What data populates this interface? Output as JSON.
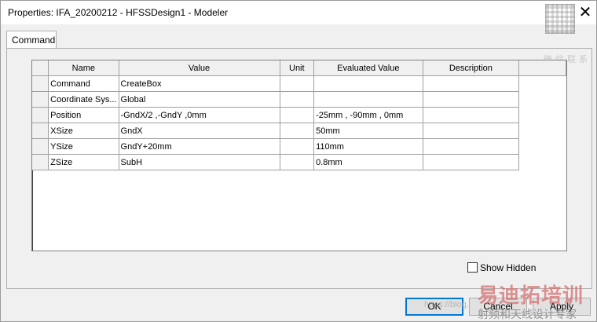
{
  "window": {
    "title": "Properties: IFA_20200212 - HFSSDesign1 - Modeler",
    "close_glyph": "✕"
  },
  "watermark": {
    "qr_caption": "微信联系",
    "url": "https://blog.",
    "cn_title": "易迪拓培训",
    "cn_subtitle": "射频和天线设计专家"
  },
  "tabs": [
    {
      "label": "Command"
    }
  ],
  "grid": {
    "columns": [
      "Name",
      "Value",
      "Unit",
      "Evaluated Value",
      "Description"
    ],
    "rows": [
      {
        "name": "Command",
        "value": "CreateBox",
        "unit": "",
        "evaluated": "",
        "description": ""
      },
      {
        "name": "Coordinate Sys...",
        "value": "Global",
        "unit": "",
        "evaluated": "",
        "description": ""
      },
      {
        "name": "Position",
        "value": "-GndX/2 ,-GndY ,0mm",
        "unit": "",
        "evaluated": "-25mm , -90mm , 0mm",
        "description": ""
      },
      {
        "name": "XSize",
        "value": "GndX",
        "unit": "",
        "evaluated": "50mm",
        "description": ""
      },
      {
        "name": "YSize",
        "value": "GndY+20mm",
        "unit": "",
        "evaluated": "110mm",
        "description": ""
      },
      {
        "name": "ZSize",
        "value": "SubH",
        "unit": "",
        "evaluated": "0.8mm",
        "description": ""
      }
    ]
  },
  "show_hidden": {
    "label": "Show Hidden",
    "checked": false
  },
  "buttons": {
    "ok": "OK",
    "cancel": "Cancel",
    "apply": "Apply"
  }
}
